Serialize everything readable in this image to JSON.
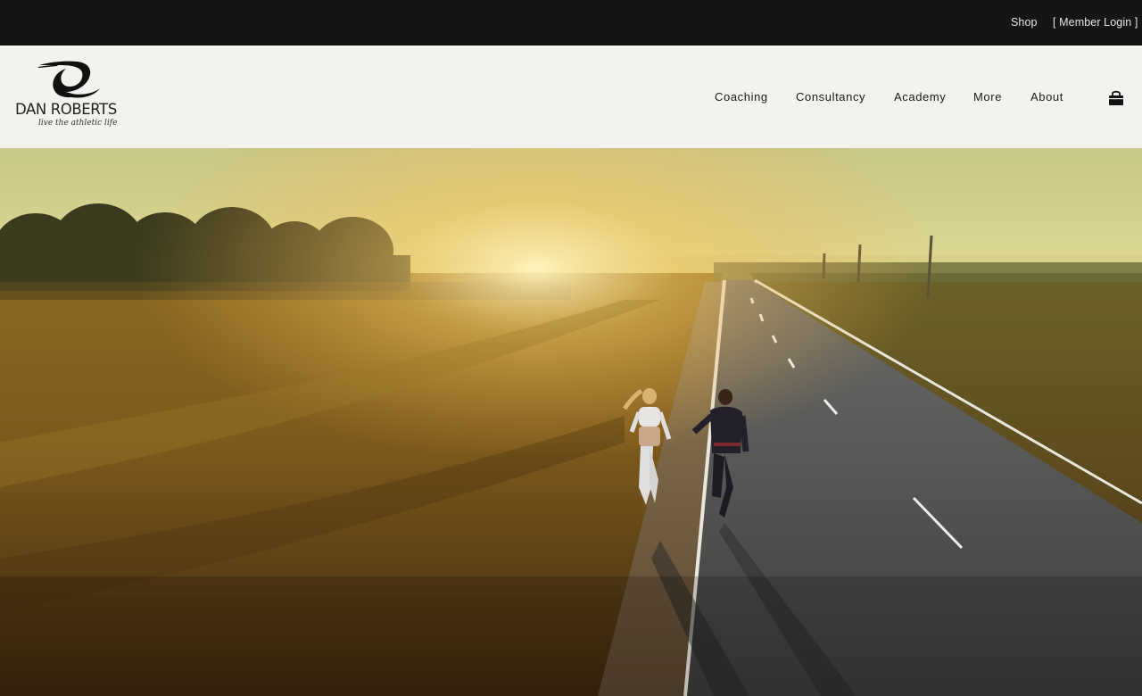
{
  "topbar": {
    "shop_label": "Shop",
    "member_login_label": "[ Member Login ]"
  },
  "brand": {
    "name": "DAN ROBERTS",
    "tagline": "live the athletic life"
  },
  "nav": {
    "items": [
      "Coaching",
      "Consultancy",
      "Academy",
      "More",
      "About"
    ]
  },
  "icons": {
    "cart": "shopping-bag-icon",
    "logo_mark": "dr-swoosh-logo-icon"
  },
  "colors": {
    "topbar_bg": "#151515",
    "header_bg": "#f3f2ee",
    "nav_text": "#1a1a1a"
  }
}
